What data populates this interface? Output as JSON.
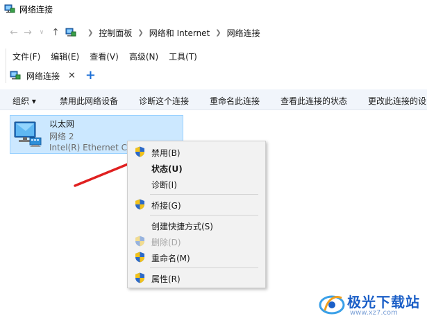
{
  "window": {
    "title": "网络连接"
  },
  "address": {
    "crumbs": [
      "控制面板",
      "网络和 Internet",
      "网络连接"
    ]
  },
  "menubar": {
    "items": [
      "文件(F)",
      "编辑(E)",
      "查看(V)",
      "高级(N)",
      "工具(T)"
    ]
  },
  "tab": {
    "label": "网络连接",
    "close": "✕",
    "add": "+"
  },
  "commands": {
    "organize": "组织 ▾",
    "disable": "禁用此网络设备",
    "diagnose": "诊断这个连接",
    "rename": "重命名此连接",
    "status": "查看此连接的状态",
    "change": "更改此连接的设"
  },
  "connection": {
    "name": "以太网",
    "network": "网络 2",
    "adapter": "Intel(R) Ethernet Connection"
  },
  "context_menu": {
    "items": [
      {
        "label": "禁用(B)",
        "icon": "shield-icon"
      },
      {
        "label": "状态(U)"
      },
      {
        "label": "诊断(I)"
      },
      {
        "label": "桥接(G)",
        "icon": "shield-icon"
      },
      {
        "label": "创建快捷方式(S)"
      },
      {
        "label": "删除(D)",
        "icon": "shield-icon",
        "disabled": true
      },
      {
        "label": "重命名(M)",
        "icon": "shield-icon"
      },
      {
        "label": "属性(R)",
        "icon": "shield-icon"
      }
    ]
  },
  "watermark": {
    "text": "极光下载站",
    "url": "www.xz7.com"
  },
  "colors": {
    "accent": "#1c6fd6",
    "selection_bg": "#cce8ff",
    "arrow": "#e02020",
    "cmdbar_bg": "#f1f5fb"
  }
}
